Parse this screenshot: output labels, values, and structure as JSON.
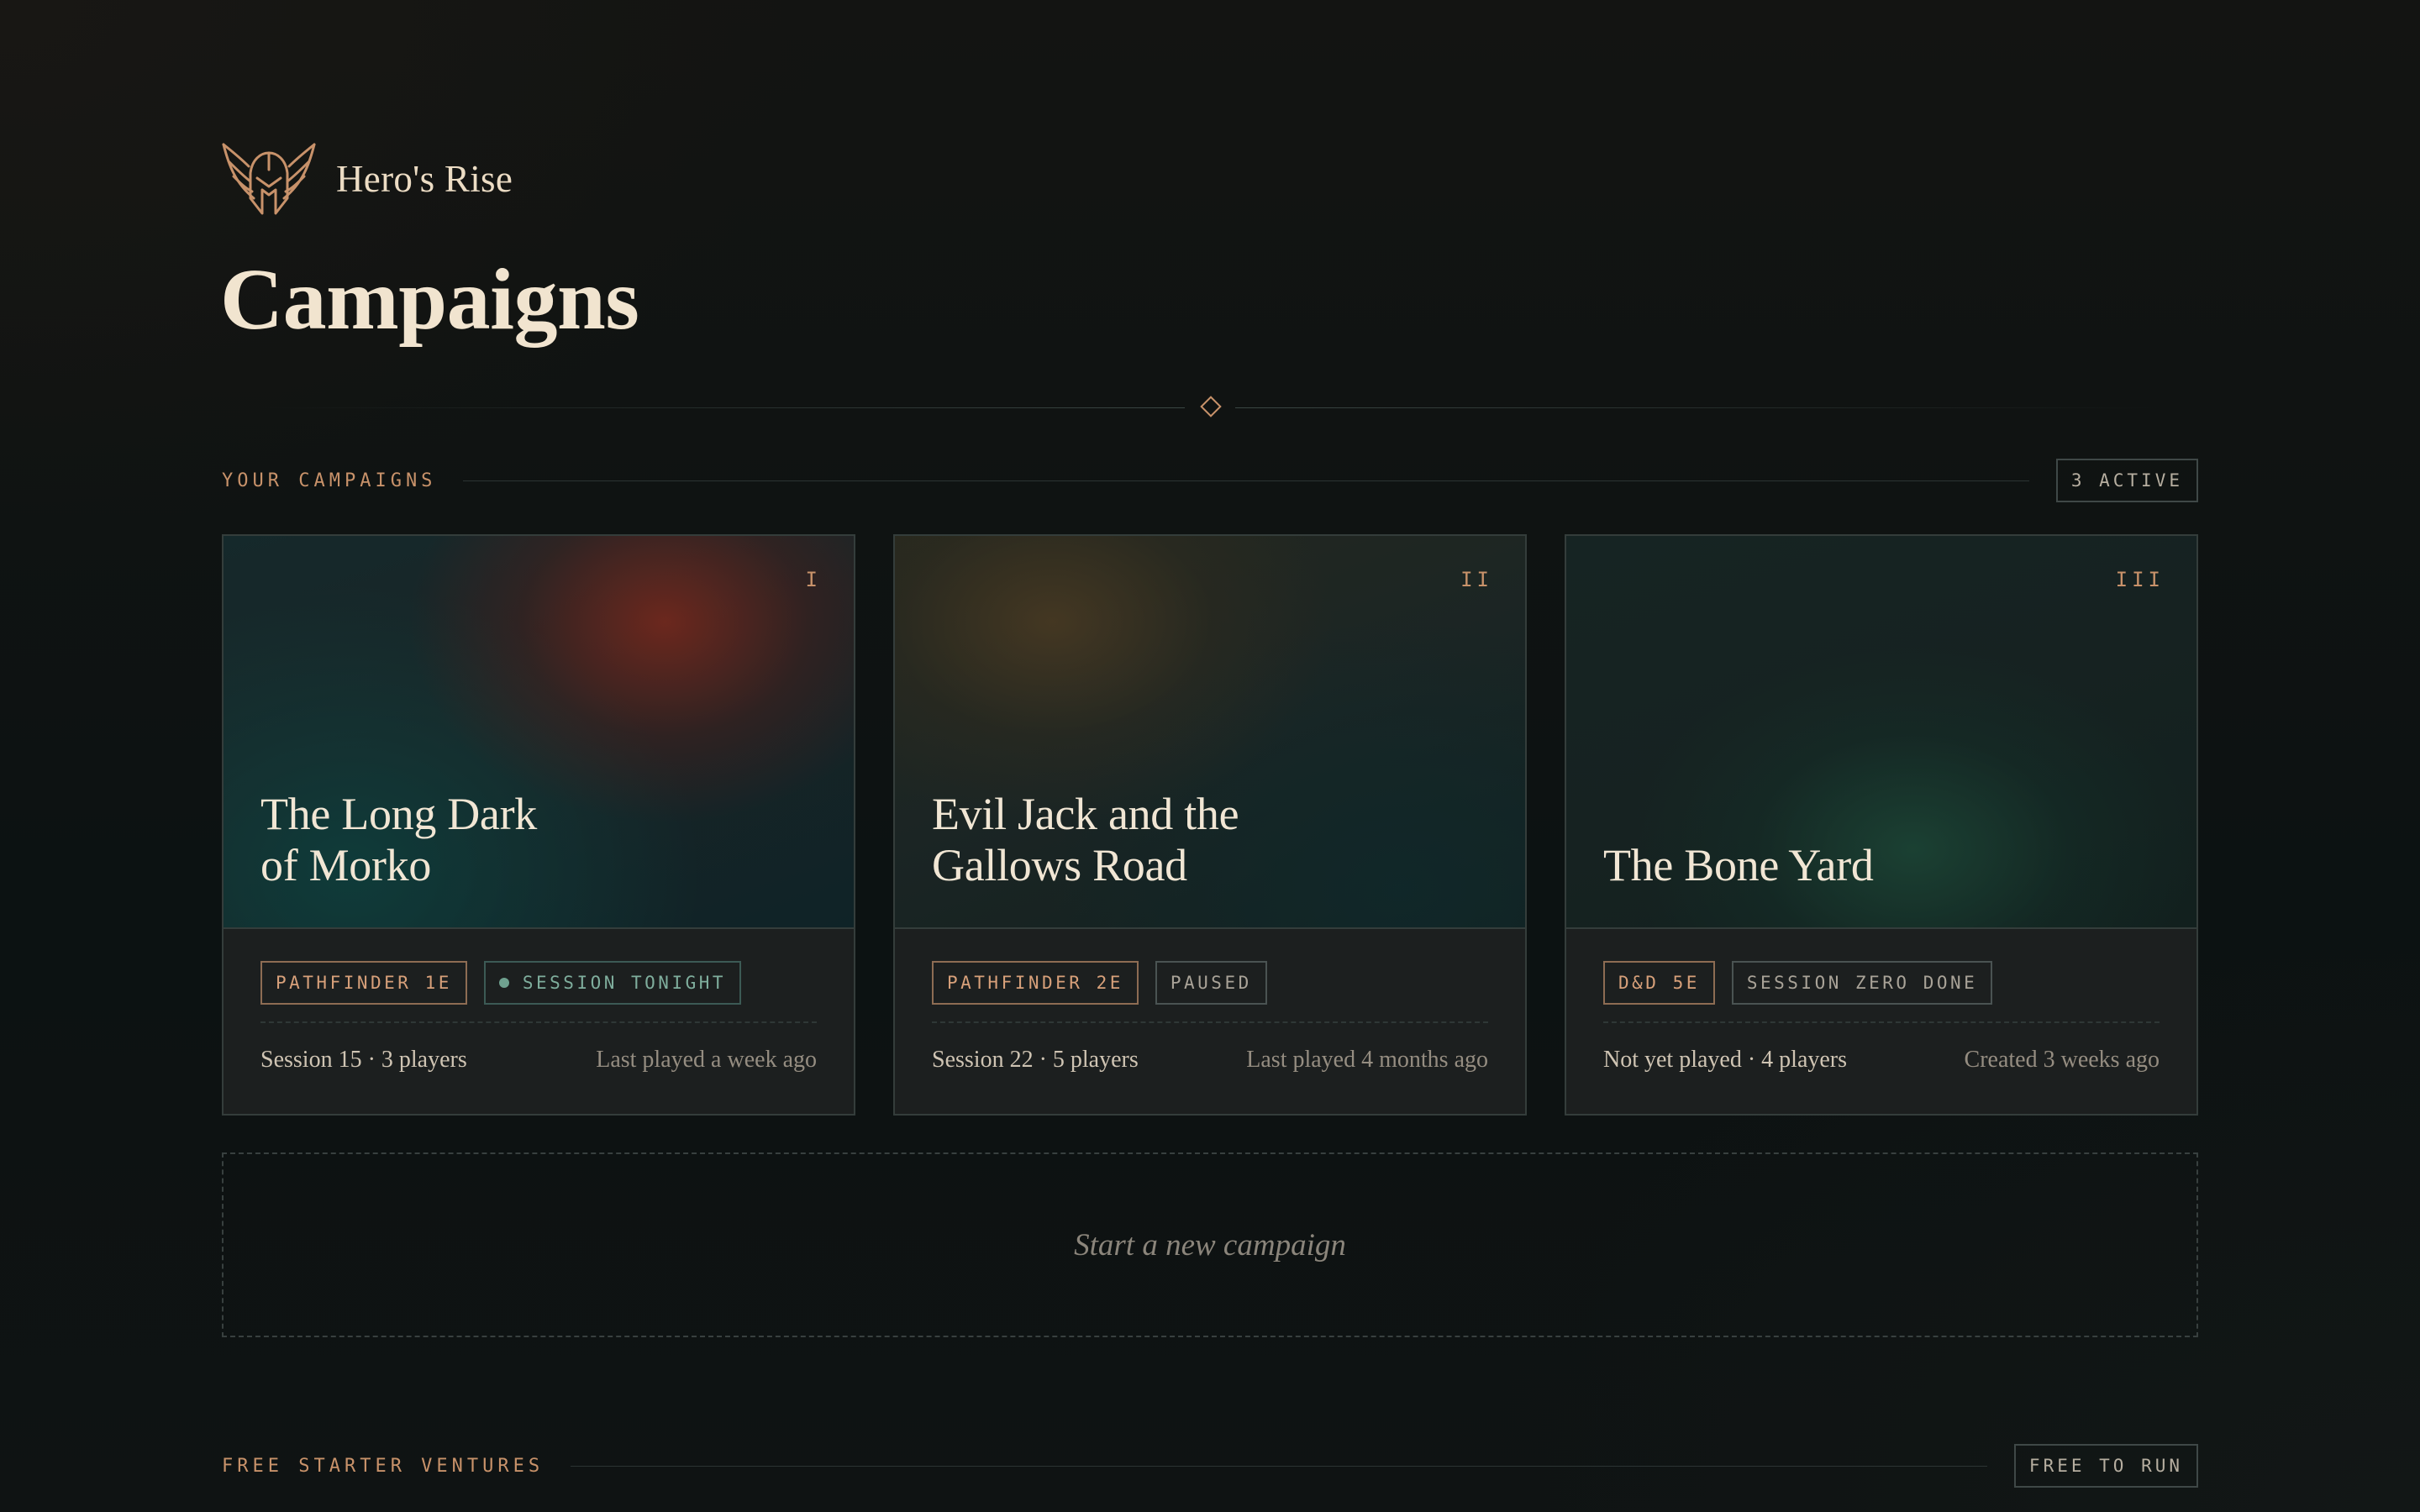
{
  "brand": {
    "name": "Hero's Rise",
    "logo_icon": "winged-helmet-icon"
  },
  "page": {
    "title": "Campaigns"
  },
  "colors": {
    "accent": "#c8926a",
    "live": "#6fa18f"
  },
  "campaigns_section": {
    "label": "YOUR CAMPAIGNS",
    "badge": "3 ACTIVE",
    "cards": [
      {
        "numeral": "I",
        "title": "The Long Dark\nof Morko",
        "system": "PATHFINDER 1E",
        "status": "SESSION TONIGHT",
        "status_live": true,
        "meta_left": "Session 15 · 3 players",
        "meta_right": "Last played a week ago"
      },
      {
        "numeral": "II",
        "title": "Evil Jack and the\nGallows Road",
        "system": "PATHFINDER 2E",
        "status": "PAUSED",
        "status_live": false,
        "meta_left": "Session 22 · 5 players",
        "meta_right": "Last played 4 months ago"
      },
      {
        "numeral": "III",
        "title": "The Bone Yard",
        "system": "D&D 5E",
        "status": "SESSION ZERO DONE",
        "status_live": false,
        "meta_left": "Not yet played · 4 players",
        "meta_right": "Created 3 weeks ago"
      }
    ]
  },
  "new_campaign": {
    "label": "Start a new campaign"
  },
  "starter_section": {
    "label": "FREE STARTER VENTURES",
    "badge": "FREE TO RUN"
  }
}
